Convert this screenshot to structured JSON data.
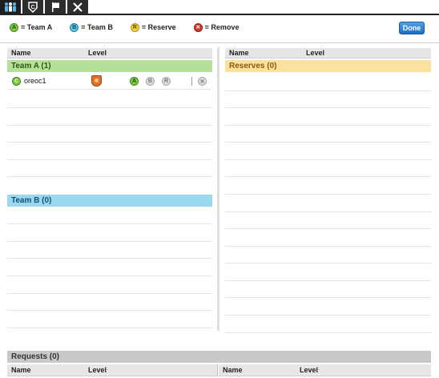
{
  "toolbar": {
    "icons": [
      "team-icon",
      "captain-icon",
      "flag-icon",
      "close-icon"
    ]
  },
  "legend": {
    "team_a": {
      "letter": "A",
      "label": "= Team A"
    },
    "team_b": {
      "letter": "B",
      "label": "= Team B"
    },
    "reserve": {
      "letter": "R",
      "label": "= Reserve"
    },
    "remove": {
      "letter": "✕",
      "label": "= Remove"
    }
  },
  "done_label": "Done",
  "left_header": {
    "name": "Name",
    "level": "Level"
  },
  "right_header": {
    "name": "Name",
    "level": "Level"
  },
  "team_a": {
    "title": "Team A (1)",
    "players": [
      {
        "rank": "C",
        "name": "oreoc1",
        "pick_a": "A",
        "pick_b": "B",
        "pick_r": "R",
        "remove": "✕"
      }
    ]
  },
  "team_b": {
    "title": "Team B (0)"
  },
  "reserves": {
    "title": "Reserves (0)"
  },
  "requests": {
    "title": "Requests (0)",
    "header_left": {
      "name": "Name",
      "level": "Level"
    },
    "header_right": {
      "name": "Name",
      "level": "Level"
    }
  },
  "colors": {
    "team_a": "#b6e09a",
    "team_b": "#9ad8ef",
    "reserve": "#fbe0a0",
    "remove": "#d23a2e",
    "done": "#1e6fc4"
  }
}
